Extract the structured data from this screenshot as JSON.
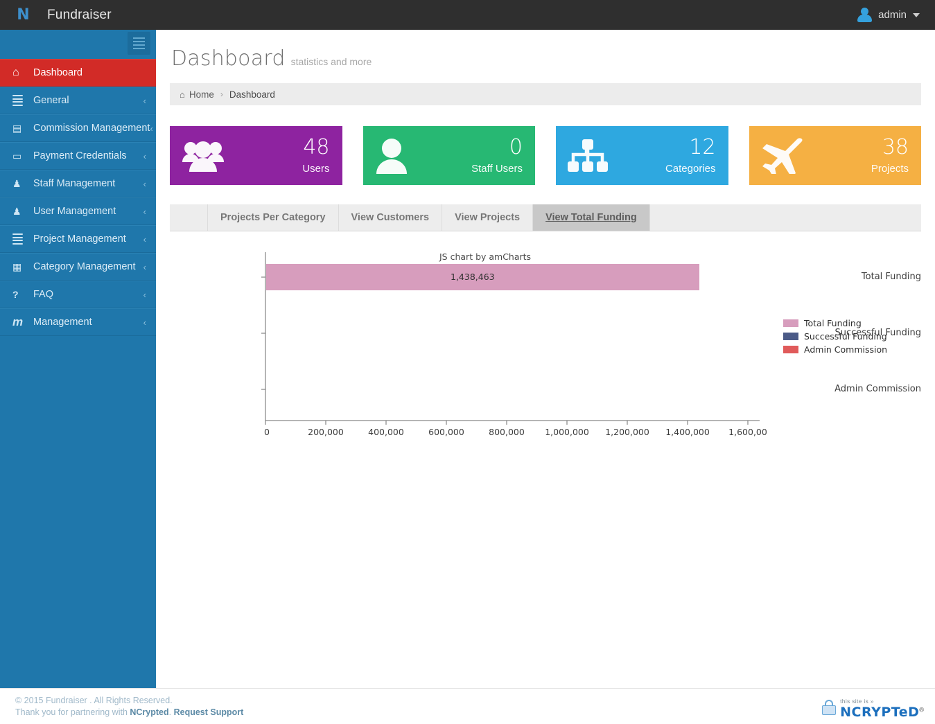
{
  "topbar": {
    "logo": "N",
    "logo_icon": "logo-n-icon",
    "app_title": "Fundraiser",
    "user_name": "admin",
    "user_icon": "user-avatar-icon",
    "caret_icon": "chevron-down-icon"
  },
  "sidebar": {
    "toggle_icon": "hamburger-menu-icon",
    "items": [
      {
        "label": "Dashboard",
        "icon": "home-icon",
        "glyph": "⌂",
        "active": true,
        "caret": ""
      },
      {
        "label": "General",
        "icon": "list-icon",
        "glyph": "≡",
        "active": false,
        "caret": "‹"
      },
      {
        "label": "Commission Management",
        "icon": "money-bill-icon",
        "glyph": "▤",
        "active": false,
        "caret": "‹"
      },
      {
        "label": "Payment Credentials",
        "icon": "credit-card-icon",
        "glyph": "▭",
        "active": false,
        "caret": "‹"
      },
      {
        "label": "Staff Management",
        "icon": "users-icon",
        "glyph": "♟",
        "active": false,
        "caret": "‹"
      },
      {
        "label": "User Management",
        "icon": "users-icon",
        "glyph": "♟",
        "active": false,
        "caret": "‹"
      },
      {
        "label": "Project Management",
        "icon": "bars-icon",
        "glyph": "≡",
        "active": false,
        "caret": "‹"
      },
      {
        "label": "Category Management",
        "icon": "window-list-icon",
        "glyph": "▦",
        "active": false,
        "caret": "‹"
      },
      {
        "label": "FAQ",
        "icon": "question-circle-icon",
        "glyph": "?",
        "active": false,
        "caret": "‹"
      },
      {
        "label": "Management",
        "icon": "m-letter-icon",
        "glyph": "m",
        "active": false,
        "caret": "‹"
      }
    ]
  },
  "page": {
    "title": "Dashboard",
    "subtitle": "statistics and more"
  },
  "breadcrumb": {
    "home_icon": "home-icon",
    "home": "Home",
    "separator": "›",
    "current": "Dashboard"
  },
  "stats": [
    {
      "value": "48",
      "caption": "Users",
      "color": "#8e23a0",
      "icon": "group-users-icon"
    },
    {
      "value": "0",
      "caption": "Staff Users",
      "color": "#27b873",
      "icon": "single-user-icon"
    },
    {
      "value": "12",
      "caption": "Categories",
      "color": "#2ea8e0",
      "icon": "sitemap-icon"
    },
    {
      "value": "38",
      "caption": "Projects",
      "color": "#f5b043",
      "icon": "plane-icon"
    }
  ],
  "tabs": [
    {
      "label": "Projects Per Category",
      "active": false
    },
    {
      "label": "View Customers",
      "active": false
    },
    {
      "label": "View Projects",
      "active": false
    },
    {
      "label": "View Total Funding",
      "active": true
    }
  ],
  "chart_data": {
    "type": "bar",
    "orientation": "horizontal",
    "credit": "JS chart by amCharts",
    "title": "",
    "xlabel": "",
    "ylabel": "",
    "categories": [
      "Total Funding",
      "Successful Funding",
      "Admin Commission"
    ],
    "values": [
      1438463,
      0,
      0
    ],
    "value_labels": [
      "1,438,463",
      "",
      ""
    ],
    "xlim": [
      0,
      1600000
    ],
    "xticks": [
      0,
      200000,
      400000,
      600000,
      800000,
      1000000,
      1200000,
      1400000,
      1600000
    ],
    "xtick_labels": [
      "0",
      "200,000",
      "400,000",
      "600,000",
      "800,000",
      "1,000,000",
      "1,200,000",
      "1,400,000",
      "1,600,00"
    ],
    "grid": false,
    "legend_position": "right",
    "series": [
      {
        "name": "Total Funding",
        "color": "#d79dbd",
        "values": [
          1438463,
          null,
          null
        ]
      },
      {
        "name": "Successful Funding",
        "color": "#4b5a87",
        "values": [
          null,
          0,
          null
        ]
      },
      {
        "name": "Admin Commission",
        "color": "#e05a5a",
        "values": [
          null,
          null,
          0
        ]
      }
    ]
  },
  "footer": {
    "line1": "© 2015 Fundraiser . All Rights Reserved.",
    "line2_prefix": "Thank you for partnering with ",
    "link1": "NCrypted",
    "line2_mid": ". ",
    "link2": "Request Support",
    "badge": {
      "icon": "padlock-icon",
      "top": "this site is »",
      "main": "NCRYPTeD",
      "reg": "®"
    }
  }
}
